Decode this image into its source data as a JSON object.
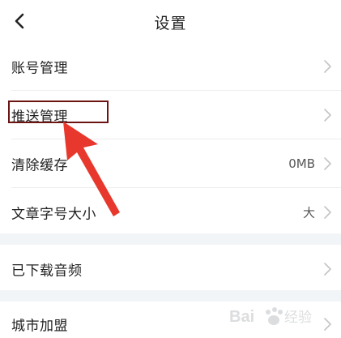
{
  "header": {
    "title": "设置"
  },
  "settings": {
    "items": [
      {
        "label": "账号管理",
        "value": ""
      },
      {
        "label": "推送管理",
        "value": ""
      },
      {
        "label": "清除缓存",
        "value": "0MB"
      },
      {
        "label": "文章字号大小",
        "value": "大"
      },
      {
        "label": "已下载音频",
        "value": ""
      },
      {
        "label": "城市加盟",
        "value": ""
      }
    ]
  },
  "icons": {
    "back": "chevron-left-icon",
    "row_arrow": "chevron-right-icon"
  },
  "colors": {
    "annotation_arrow": "#e8382d",
    "annotation_box": "#6b1512",
    "section_gap": "#f2f5f7"
  }
}
